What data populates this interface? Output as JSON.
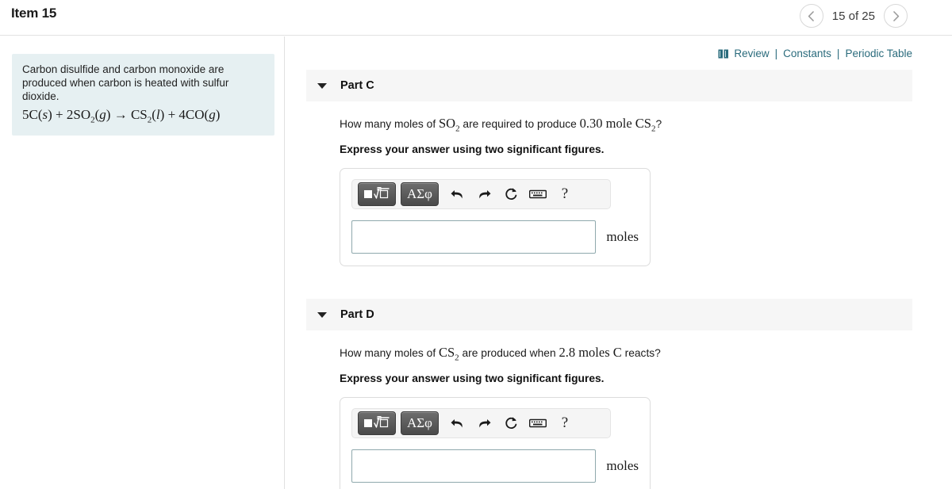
{
  "header": {
    "item_title": "Item 15",
    "pagination_label": "15 of 25",
    "prev_icon": "chevron-left-icon",
    "next_icon": "chevron-right-icon"
  },
  "toplinks": {
    "book_icon": "book-icon",
    "review": "Review",
    "separator": "|",
    "constants": "Constants",
    "periodic_table": "Periodic Table",
    "color": "#2a6b7c"
  },
  "problem": {
    "description": "Carbon disulfide and carbon monoxide are produced when carbon is heated with sulfur dioxide.",
    "equation_plain": "5C(s) + 2SO2(g) → CS2(l) + 4CO(g)",
    "background_color": "#e6f0f2"
  },
  "parts": [
    {
      "caret_icon": "caret-down-icon",
      "label": "Part C",
      "question_prefix": "How many moles of ",
      "question_formula1": "SO",
      "question_formula1_sub": "2",
      "question_mid": " are required to produce ",
      "question_value": "0.30 mole ",
      "question_formula2": "CS",
      "question_formula2_sub": "2",
      "question_suffix": "?",
      "instruction": "Express your answer using two significant figures.",
      "input_value": "",
      "input_placeholder": "",
      "unit": "moles",
      "toolbar": {
        "template_button": "math-template-button",
        "greek_button": "ΑΣφ",
        "undo": "undo-icon",
        "redo": "redo-icon",
        "reset": "reset-icon",
        "keyboard": "keyboard-icon",
        "help": "?"
      }
    },
    {
      "caret_icon": "caret-down-icon",
      "label": "Part D",
      "question_prefix": "How many moles of ",
      "question_formula1": "CS",
      "question_formula1_sub": "2",
      "question_mid": " are produced when ",
      "question_value": "2.8 moles ",
      "question_formula2": "C",
      "question_formula2_sub": "",
      "question_suffix": " reacts?",
      "instruction": "Express your answer using two significant figures.",
      "input_value": "",
      "input_placeholder": "",
      "unit": "moles",
      "toolbar": {
        "template_button": "math-template-button",
        "greek_button": "ΑΣφ",
        "undo": "undo-icon",
        "redo": "redo-icon",
        "reset": "reset-icon",
        "keyboard": "keyboard-icon",
        "help": "?"
      }
    }
  ]
}
